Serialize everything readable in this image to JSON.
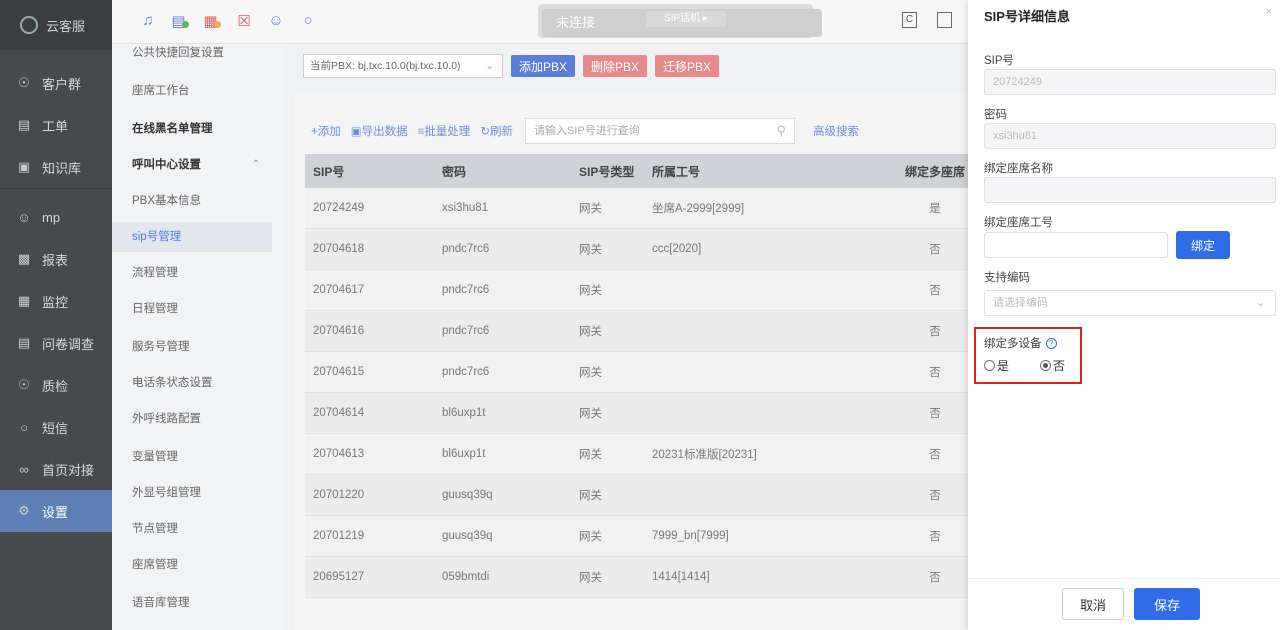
{
  "app": {
    "name": "云客服"
  },
  "nav": {
    "items": [
      {
        "label": "客户群",
        "icon": "user-group-icon"
      },
      {
        "label": "工单",
        "icon": "ticket-icon"
      },
      {
        "label": "知识库",
        "icon": "book-icon"
      },
      {
        "label": "mp",
        "icon": "users-icon"
      },
      {
        "label": "报表",
        "icon": "bar-chart-icon"
      },
      {
        "label": "监控",
        "icon": "monitor-icon"
      },
      {
        "label": "问卷调查",
        "icon": "survey-icon"
      },
      {
        "label": "质检",
        "icon": "shield-check-icon"
      },
      {
        "label": "短信",
        "icon": "chat-icon"
      },
      {
        "label": "首页对接",
        "icon": "link-icon"
      },
      {
        "label": "设置",
        "icon": "gear-icon"
      }
    ],
    "active": "设置"
  },
  "topbar": {
    "sip_status": "未连接",
    "sip_phone": "SIP话机 ▸"
  },
  "submenu": {
    "items": [
      {
        "label": "公共快捷回复设置"
      },
      {
        "label": "座席工作台"
      },
      {
        "label": "在线黑名单管理"
      },
      {
        "label": "呼叫中心设置"
      },
      {
        "label": "PBX基本信息"
      },
      {
        "label": "sip号管理"
      },
      {
        "label": "流程管理"
      },
      {
        "label": "日程管理"
      },
      {
        "label": "服务号管理"
      },
      {
        "label": "电话条状态设置"
      },
      {
        "label": "外呼线路配置"
      },
      {
        "label": "变量管理"
      },
      {
        "label": "外显号组管理"
      },
      {
        "label": "节点管理"
      },
      {
        "label": "座席管理"
      },
      {
        "label": "语音库管理"
      }
    ]
  },
  "pbx": {
    "current": "当前PBX: bj.txc.10.0(bj.txc.10.0)",
    "add": "添加PBX",
    "delete": "删除PBX",
    "migrate": "迁移PBX"
  },
  "toolbar": {
    "add": "+添加",
    "export": "导出数据",
    "batch": "批量处理",
    "refresh": "刷新",
    "search_placeholder": "请输入SIP号进行查询",
    "advanced": "高级搜索"
  },
  "table": {
    "headers": [
      "SIP号",
      "密码",
      "SIP号类型",
      "所属工号",
      "绑定多座席"
    ],
    "rows": [
      [
        "20724249",
        "xsi3hu81",
        "网关",
        "坐席A-2999[2999]",
        "是"
      ],
      [
        "20704618",
        "pndc7rc6",
        "网关",
        "ccc[2020]",
        "否"
      ],
      [
        "20704617",
        "pndc7rc6",
        "网关",
        "",
        "否"
      ],
      [
        "20704616",
        "pndc7rc6",
        "网关",
        "",
        "否"
      ],
      [
        "20704615",
        "pndc7rc6",
        "网关",
        "",
        "否"
      ],
      [
        "20704614",
        "bl6uxp1t",
        "网关",
        "",
        "否"
      ],
      [
        "20704613",
        "bl6uxp1t",
        "网关",
        "20231标准版[20231]",
        "否"
      ],
      [
        "20701220",
        "guusq39q",
        "网关",
        "",
        "否"
      ],
      [
        "20701219",
        "guusq39q",
        "网关",
        "7999_bn[7999]",
        "否"
      ],
      [
        "20695127",
        "059bmtdi",
        "网关",
        "1414[1414]",
        "否"
      ]
    ]
  },
  "drawer": {
    "title": "SIP号详细信息",
    "close": "×",
    "sip_label": "SIP号",
    "sip_value": "20724249",
    "pwd_label": "密码",
    "pwd_value": "xsi3hu81",
    "agent_name_label": "绑定座席名称",
    "agent_no_label": "绑定座席工号",
    "bind_btn": "绑定",
    "codec_label": "支持编码",
    "codec_placeholder": "请选择编码",
    "multi_label": "绑定多设备",
    "yes": "是",
    "no": "否",
    "selected": "否",
    "cancel": "取消",
    "save": "保存"
  },
  "colors": {
    "primary": "#2f6de8",
    "danger": "#e02020",
    "nav_active": "#5d7fb4"
  }
}
